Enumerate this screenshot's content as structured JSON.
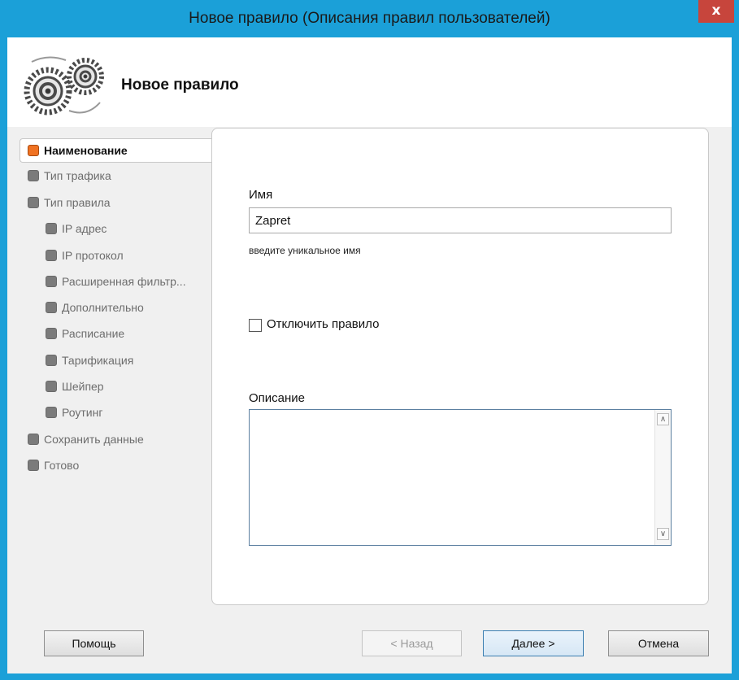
{
  "window": {
    "title": "Новое правило (Описания правил пользователей)",
    "close_glyph": "x"
  },
  "header": {
    "title": "Новое правило",
    "icon": "gears-icon"
  },
  "nav": {
    "items": [
      {
        "label": "Наименование",
        "active": true
      },
      {
        "label": "Тип трафика"
      },
      {
        "label": "Тип правила"
      },
      {
        "label": "IP адрес"
      },
      {
        "label": "IP протокол"
      },
      {
        "label": "Расширенная фильтр..."
      },
      {
        "label": "Дополнительно"
      },
      {
        "label": "Расписание"
      },
      {
        "label": "Тарификация"
      },
      {
        "label": "Шейпер"
      },
      {
        "label": "Роутинг"
      },
      {
        "label": "Сохранить данные"
      },
      {
        "label": "Готово"
      }
    ]
  },
  "form": {
    "name_label": "Имя",
    "name_value": "Zapret",
    "name_hint": "введите уникальное имя",
    "disable_label": "Отключить правило",
    "disable_checked": false,
    "description_label": "Описание",
    "description_value": "",
    "scroll_up_glyph": "∧",
    "scroll_down_glyph": "∨"
  },
  "footer": {
    "help_label": "Помощь",
    "back_label": "< Назад",
    "next_label": "Далее >",
    "cancel_label": "Отмена"
  },
  "colors": {
    "titlebar": "#1ba0d8",
    "close_button": "#c7453c",
    "active_bullet": "#f07222",
    "inactive_bullet": "#7b7b7b"
  }
}
